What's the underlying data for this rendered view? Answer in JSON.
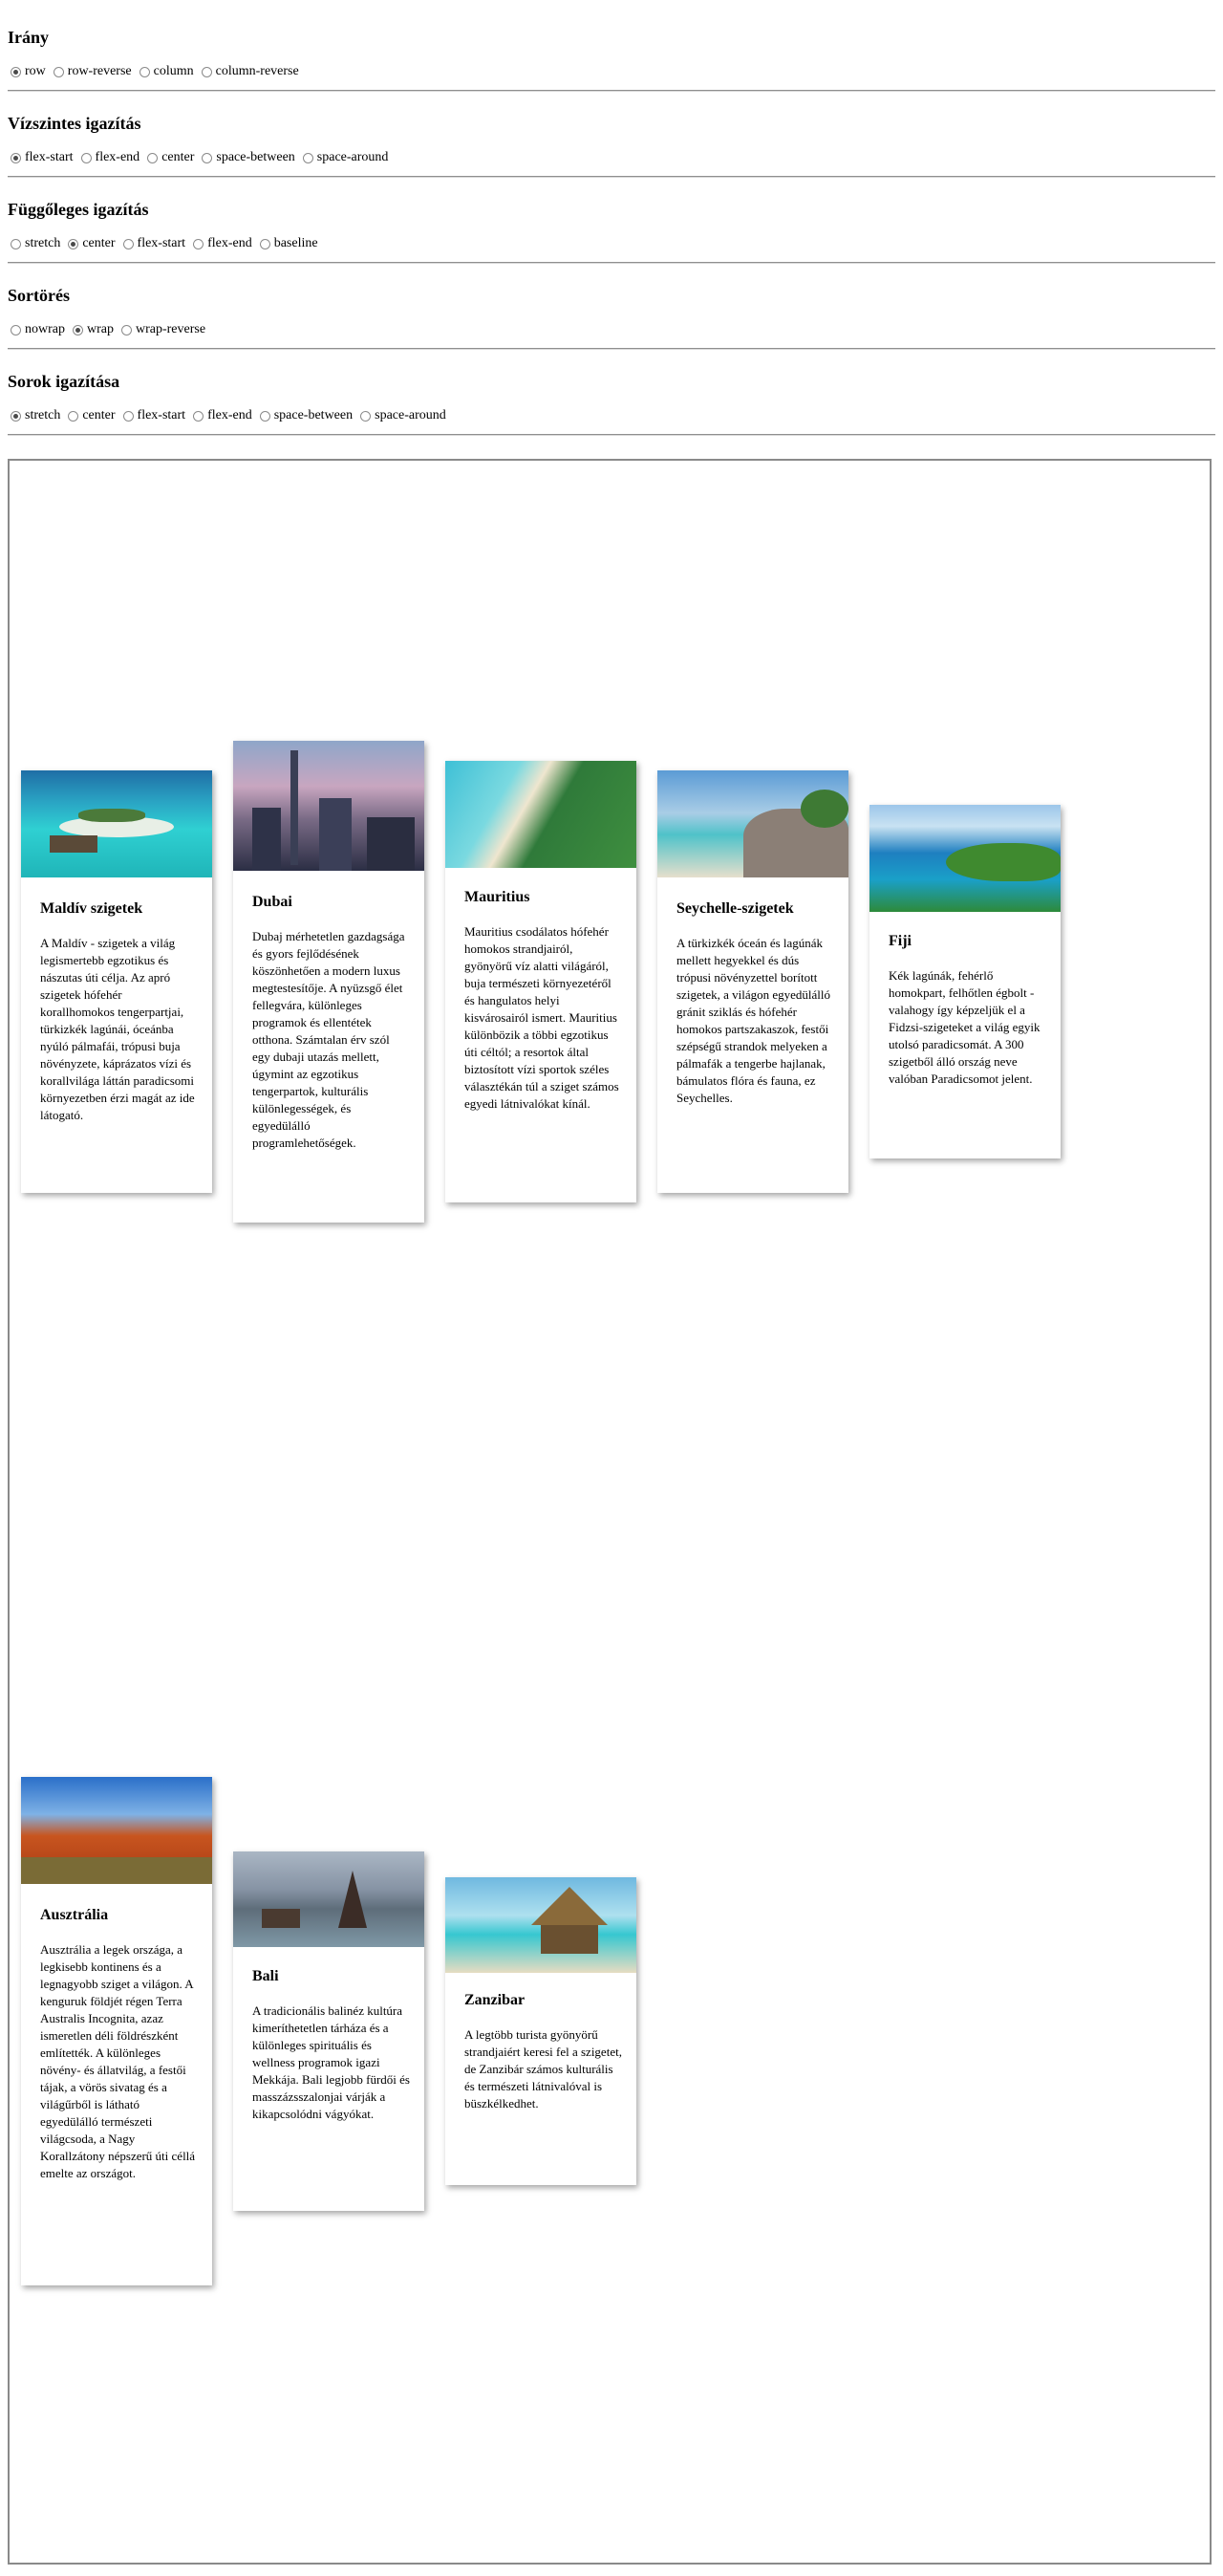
{
  "controls": [
    {
      "title": "Irány",
      "options": [
        "row",
        "row-reverse",
        "column",
        "column-reverse"
      ],
      "selected": 0
    },
    {
      "title": "Vízszintes igazítás",
      "options": [
        "flex-start",
        "flex-end",
        "center",
        "space-between",
        "space-around"
      ],
      "selected": 0
    },
    {
      "title": "Függőleges igazítás",
      "options": [
        "stretch",
        "center",
        "flex-start",
        "flex-end",
        "baseline"
      ],
      "selected": 1
    },
    {
      "title": "Sortörés",
      "options": [
        "nowrap",
        "wrap",
        "wrap-reverse"
      ],
      "selected": 1
    },
    {
      "title": "Sorok igazítása",
      "options": [
        "stretch",
        "center",
        "flex-start",
        "flex-end",
        "space-between",
        "space-around"
      ],
      "selected": 0
    }
  ],
  "cards": [
    {
      "title": "Maldív szigetek",
      "image": "maldives-resort-photo",
      "text": "A Maldív - szigetek a világ legismertebb egzotikus és nászutas úti célja. Az apró szigetek hófehér korallhomokos tengerpartjai, türkizkék lagúnái, óceánba nyúló pálmafái, trópusi buja növényzete, káprázatos vízi és korallvilága láttán paradicsomi környezetben érzi magát az ide látogató."
    },
    {
      "title": "Dubai",
      "image": "dubai-skyline-photo",
      "text": "Dubaj mérhetetlen gazdagsága és gyors fejlődésének köszönhetően a modern luxus megtestesítője. A nyüzsgő élet fellegvára, különleges programok és ellentétek otthona. Számtalan érv szól egy dubaji utazás mellett, úgymint az egzotikus tengerpartok, kulturális különlegességek, és egyedülálló programlehetőségek."
    },
    {
      "title": "Mauritius",
      "image": "mauritius-beach-photo",
      "text": "Mauritius csodálatos hófehér homokos strandjairól, gyönyörű víz alatti világáról, buja természeti környezetéről és hangulatos helyi kisvárosairól ismert. Mauritius különbözik a többi egzotikus úti céltól; a resortok által biztosított vízi sportok széles választékán túl a sziget számos egyedi látnivalókat kínál."
    },
    {
      "title": "Seychelle-szigetek",
      "image": "seychelles-rocks-photo",
      "text": "A türkizkék óceán és lagúnák mellett hegyekkel és dús trópusi növényzettel borított szigetek, a világon egyedülálló gránit sziklás és hófehér homokos partszakaszok, festői szépségű strandok melyeken a pálmafák a tengerbe hajlanak, bámulatos flóra és fauna, ez Seychelles."
    },
    {
      "title": "Fiji",
      "image": "fiji-lagoon-photo",
      "text": "Kék lagúnák, fehérlő homokpart, felhőtlen égbolt - valahogy így képzeljük el a Fidzsi-szigeteket a világ egyik utolsó paradicsomát. A 300 szigetből álló ország neve valóban Paradicsomot jelent."
    },
    {
      "title": "Ausztrália",
      "image": "australia-uluru-photo",
      "text": "Ausztrália a legek országa, a legkisebb kontinens és a legnagyobb sziget a világon. A kenguruk földjét régen Terra Australis Incognita, azaz ismeretlen déli földrészként említették. A különleges növény- és állatvilág, a festői tájak, a vörös sivatag és a világűrből is látható egyedülálló természeti világcsoda, a Nagy Korallzátony népszerű úti céllá emelte az országot."
    },
    {
      "title": "Bali",
      "image": "bali-temple-photo",
      "text": "A tradicionális balinéz kultúra kimeríthetetlen tárháza és a különleges spirituális és wellness programok igazi Mekkája. Bali legjobb fürdői és masszázsszalonjai várják a kikapcsolódni vágyókat."
    },
    {
      "title": "Zanzibar",
      "image": "zanzibar-hut-photo",
      "text": "A legtöbb turista gyönyörű strandjaiért keresi fel a szigetet, de Zanzibár számos kulturális és természeti látnivalóval is büszkélkedhet."
    }
  ]
}
